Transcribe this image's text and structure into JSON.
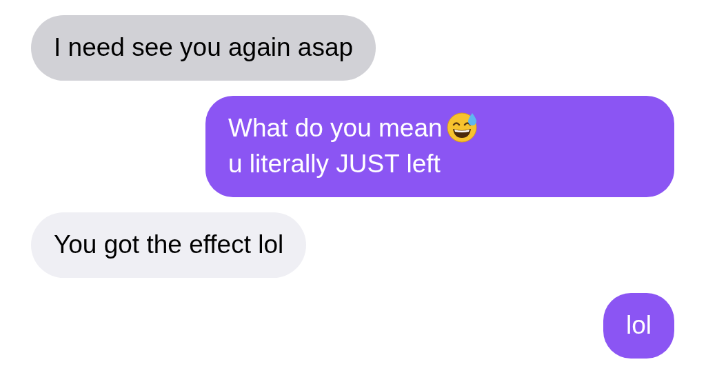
{
  "messages": [
    {
      "kind": "incoming",
      "color": "#d1d1d6",
      "parts": [
        {
          "kind": "text",
          "text": "I need see you again asap"
        }
      ]
    },
    {
      "kind": "outgoing",
      "color": "#8b55f3",
      "parts": [
        {
          "kind": "text",
          "text": "What do you mean"
        },
        {
          "kind": "emoji"
        },
        {
          "kind": "text",
          "text": "u literally"
        },
        {
          "kind": "text",
          "text": "JUST left"
        }
      ]
    },
    {
      "kind": "incoming",
      "color": "#efeff4",
      "parts": [
        {
          "kind": "text",
          "text": "You got the effect lol"
        }
      ]
    },
    {
      "kind": "outgoing",
      "color": "#8b55f3",
      "parts": [
        {
          "kind": "text",
          "text": "lol"
        }
      ]
    }
  ]
}
